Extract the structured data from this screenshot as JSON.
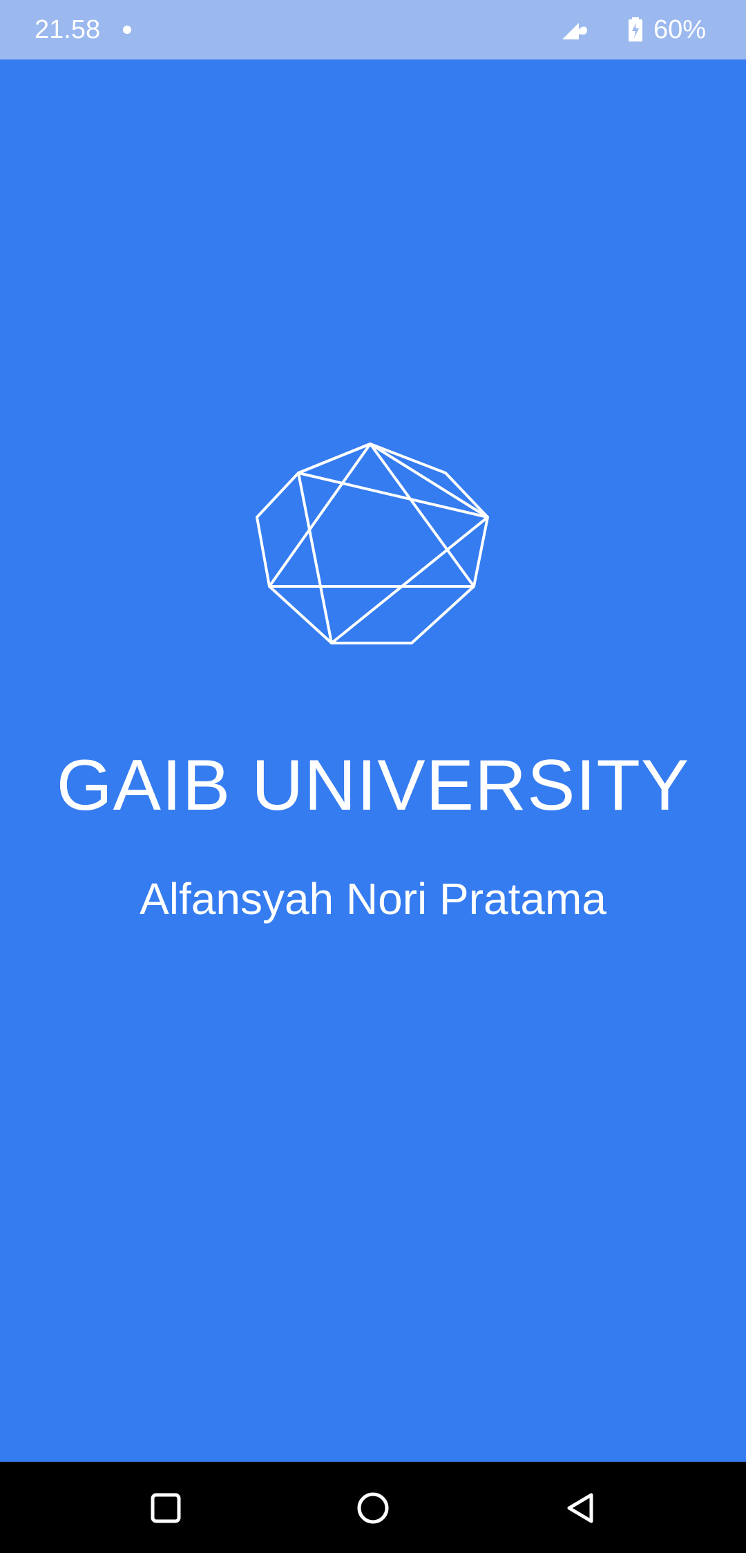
{
  "status_bar": {
    "time": "21.58",
    "battery": "60%"
  },
  "icons": {
    "notification": "dot-icon",
    "signal": "signal-icon",
    "battery": "battery-charging-icon",
    "logo": "geometric-logo-icon",
    "recents": "square-icon",
    "home": "circle-icon",
    "back": "triangle-back-icon"
  },
  "colors": {
    "background": "#357cf0",
    "status_bar": "#9bb9ef",
    "nav_bar": "#000000",
    "text": "#ffffff"
  },
  "splash": {
    "title": "GAIB UNIVERSITY",
    "subtitle": "Alfansyah Nori Pratama"
  }
}
